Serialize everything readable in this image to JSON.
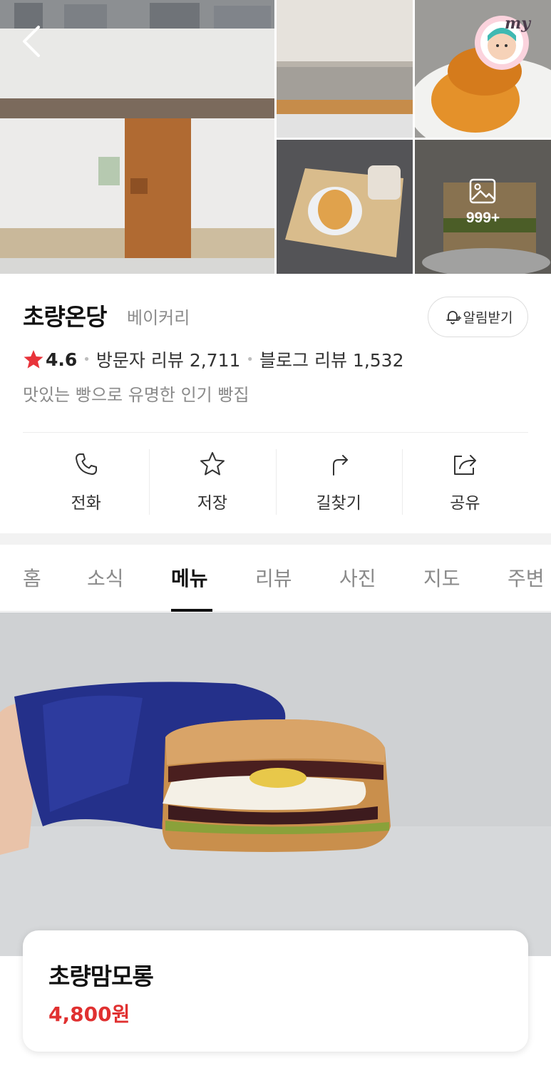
{
  "gallery": {
    "more_count": "999+",
    "badge_text": "my"
  },
  "place": {
    "name": "초량온당",
    "category": "베이커리",
    "alarm_label": "알림받기",
    "rating": "4.6",
    "visitor_reviews": "방문자 리뷰 2,711",
    "blog_reviews": "블로그 리뷰 1,532",
    "description": "맛있는 빵으로 유명한 인기 빵집"
  },
  "actions": [
    {
      "label": "전화",
      "icon": "phone-icon"
    },
    {
      "label": "저장",
      "icon": "star-icon"
    },
    {
      "label": "길찾기",
      "icon": "directions-icon"
    },
    {
      "label": "공유",
      "icon": "share-icon"
    }
  ],
  "tabs": [
    {
      "label": "홈"
    },
    {
      "label": "소식"
    },
    {
      "label": "메뉴",
      "active": true
    },
    {
      "label": "리뷰"
    },
    {
      "label": "사진"
    },
    {
      "label": "지도"
    },
    {
      "label": "주변"
    }
  ],
  "menu": {
    "name": "초량맘모롱",
    "price": "4,800원"
  },
  "colors": {
    "rating_star": "#e8333a",
    "price": "#e03030",
    "active_tab": "#111111",
    "inactive_tab": "#8a8a8a"
  }
}
